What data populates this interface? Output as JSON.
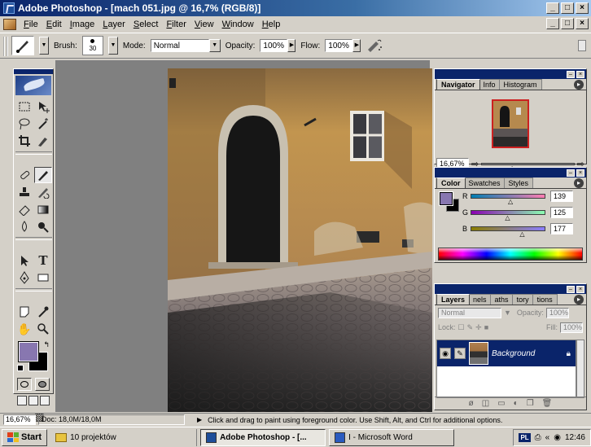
{
  "window": {
    "title": "Adobe Photoshop - [mach 051.jpg @ 16,7% (RGB/8)]",
    "min": "_",
    "max": "□",
    "close": "×"
  },
  "menu": [
    "File",
    "Edit",
    "Image",
    "Layer",
    "Select",
    "Filter",
    "View",
    "Window",
    "Help"
  ],
  "options": {
    "brush_label": "Brush:",
    "brush_size": "30",
    "mode_label": "Mode:",
    "mode_value": "Normal",
    "opacity_label": "Opacity:",
    "opacity_value": "100%",
    "flow_label": "Flow:",
    "flow_value": "100%"
  },
  "navigator": {
    "tabs": [
      "Navigator",
      "Info",
      "Histogram"
    ],
    "zoom": "16,67%"
  },
  "color": {
    "tabs": [
      "Color",
      "Swatches",
      "Styles"
    ],
    "foreground": "#8877b0",
    "background": "#000000",
    "r_label": "R",
    "r_value": "139",
    "g_label": "G",
    "g_value": "125",
    "b_label": "B",
    "b_value": "177"
  },
  "layers": {
    "tabs": [
      "Layers",
      "nels",
      "aths",
      "tory",
      "tions"
    ],
    "blend_mode": "Normal",
    "opacity_label": "Opacity:",
    "opacity_value": "100%",
    "lock_label": "Lock:",
    "fill_label": "Fill:",
    "fill_value": "100%",
    "layer_name": "Background"
  },
  "status": {
    "zoom": "16,67%",
    "doc": "Doc: 18,0M/18,0M",
    "hint": "Click and drag to paint using foreground color.  Use Shift, Alt, and Ctrl for additional options."
  },
  "taskbar": {
    "start": "Start",
    "folder": "10 projektów",
    "task_ps": "Adobe Photoshop - [...",
    "task_word": "I - Microsoft Word",
    "lang": "PL",
    "time": "12:46"
  }
}
